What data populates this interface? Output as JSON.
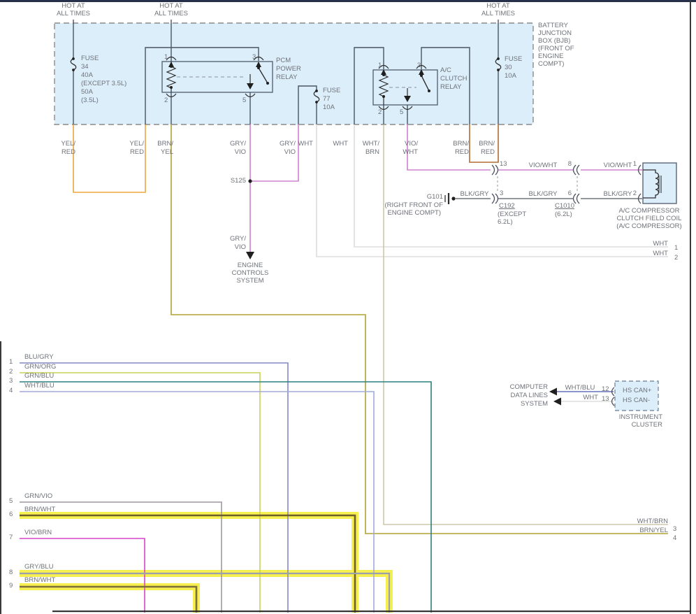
{
  "hot_label": [
    "HOT AT",
    "ALL TIMES"
  ],
  "bjb_label": [
    "BATTERY",
    "JUNCTION",
    "BOX (BJB)",
    "(FRONT OF",
    "ENGINE",
    "COMPT)"
  ],
  "fuse34": [
    "FUSE",
    "34",
    "40A",
    "(EXCEPT 3.5L)",
    "50A",
    "(3.5L)"
  ],
  "fuse77": [
    "FUSE",
    "77",
    "10A"
  ],
  "fuse30": [
    "FUSE",
    "30",
    "10A"
  ],
  "pcm_relay": {
    "name": [
      "PCM",
      "POWER",
      "RELAY"
    ],
    "pins": {
      "p1": "1",
      "p2": "2",
      "p3": "3",
      "p5": "5"
    }
  },
  "ac_relay": {
    "name": [
      "A/C",
      "CLUTCH",
      "RELAY"
    ],
    "pins": {
      "p1": "1",
      "p2": "2",
      "p3": "3",
      "p5": "5"
    }
  },
  "wires": {
    "yel_red": [
      "YEL/",
      "RED"
    ],
    "brn_yel": [
      "BRN/",
      "YEL"
    ],
    "gry_vio": [
      "GRY/",
      "VIO"
    ],
    "wht": "WHT",
    "wht_brn": [
      "WHT/",
      "BRN"
    ],
    "vio_wht": [
      "VIO/",
      "WHT"
    ],
    "brn_red": [
      "BRN/",
      "RED"
    ]
  },
  "s125_label": "S125",
  "engine_controls_label": [
    "ENGINE",
    "CONTROLS",
    "SYSTEM"
  ],
  "g101": {
    "name": "G101",
    "location": [
      "(RIGHT FRONT OF",
      "ENGINE COMPT)"
    ]
  },
  "field_coil": {
    "vio_wht_row": {
      "label": "VIO/WHT",
      "pin_a": "13",
      "pin_b": "8",
      "pin_c": "1"
    },
    "blk_gry_row": {
      "label": "BLK/GRY",
      "pin_a": "3",
      "pin_b": "6",
      "pin_c": "2"
    },
    "c192": {
      "name": "C192",
      "note": [
        "(EXCEPT",
        "6.2L)"
      ]
    },
    "c1010": {
      "name": "C1010",
      "note": "(6.2L)"
    },
    "label": [
      "A/C COMPRESSOR",
      "CLUTCH FIELD COIL",
      "(A/C COMPRESSOR)"
    ]
  },
  "right_rows": [
    {
      "label": "WHT",
      "num": "1"
    },
    {
      "label": "WHT",
      "num": "2"
    },
    {
      "label": "WHT/BRN",
      "num": "3"
    },
    {
      "label": "BRN/YEL",
      "num": "4"
    }
  ],
  "cluster": {
    "system": [
      "COMPUTER",
      "DATA LINES",
      "SYSTEM"
    ],
    "rows": [
      {
        "label": "WHT/BLU",
        "pin": "12",
        "name": "HS CAN+"
      },
      {
        "label": "WHT",
        "pin": "13",
        "name": "HS CAN-"
      }
    ],
    "name": [
      "INSTRUMENT",
      "CLUSTER"
    ]
  },
  "left_rows": [
    {
      "num": "1",
      "label": "BLU/GRY"
    },
    {
      "num": "2",
      "label": "GRN/ORG"
    },
    {
      "num": "3",
      "label": "GRN/BLU"
    },
    {
      "num": "4",
      "label": "WHT/BLU"
    },
    {
      "num": "5",
      "label": "GRN/VIO"
    },
    {
      "num": "6",
      "label": "BRN/WHT"
    },
    {
      "num": "7",
      "label": "VIO/BRN"
    },
    {
      "num": "8",
      "label": "GRY/BLU"
    },
    {
      "num": "9",
      "label": "BRN/WHT"
    }
  ],
  "colors": {
    "bjb_fill": "#ddeefb",
    "highlight": "#f6ee3c",
    "yel_red": "#eda73f",
    "brn_yel": "#b3a232",
    "gry_vio": "#cf82cd",
    "vio_wht": "#cf82cd",
    "wht": "#dedede",
    "wht_brn": "#cfc6ab",
    "brn_red": "#b06c34",
    "blk_gry": "#70757d",
    "blu_gry": "#8289c6",
    "grn_org": "#c9d158",
    "grn_blu": "#2f7e7e",
    "wht_blu": "#9facd9",
    "grn_vio": "#9e97a0",
    "brn_wht": "#6f5f2c",
    "vio_brn": "#d844c6",
    "gry_blu": "#9aa1ab"
  }
}
